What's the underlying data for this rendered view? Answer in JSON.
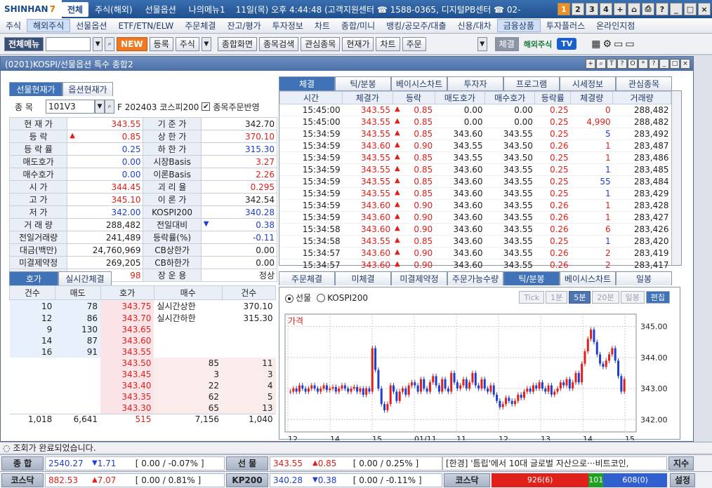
{
  "titlebar": {
    "logo": "SHINHAN",
    "logo_num": "7",
    "menus": [
      "전체",
      "주식(해외)",
      "선물옵션",
      "나의메뉴1"
    ],
    "active_menu": "전체",
    "info": "11일(목) 오후 4:44:48 (고객지원센터 ☎ 1588-0365, 디지털PB센터 ☎ 02-",
    "nums": [
      "1",
      "2",
      "3",
      "4",
      "+"
    ]
  },
  "menubar": [
    "주식",
    "해외주식",
    "선물옵션",
    "ETF/ETN/ELW",
    "주문체결",
    "잔고/평가",
    "투자정보",
    "차트",
    "종합/미니",
    "뱅킹/공모주/대출",
    "신용/대차",
    "금융상품",
    "투자플러스",
    "온라인지점"
  ],
  "menubar_selected": [
    "해외주식",
    "금융상품"
  ],
  "toolbar": {
    "allmenu": "전체메뉴",
    "new": "NEW",
    "buttons": [
      "등록",
      "주식"
    ],
    "buttons2": [
      "종합화면",
      "종목검색",
      "관심종목",
      "현재가",
      "차트",
      "주문"
    ],
    "fill": "체결",
    "brand": "해외주식",
    "tv": "TV"
  },
  "window": {
    "title": "(0201)KOSPI/선물옵션 특수 종합2"
  },
  "lefttabs": [
    "선물현재가",
    "옵션현재가"
  ],
  "code": {
    "label": "종  목",
    "value": "101V3",
    "name": "F 202403 코스피200",
    "check_label": "종목주문반영"
  },
  "quote": [
    [
      "현 재 가",
      "343.55",
      "red",
      "",
      "기 준 가",
      "342.70",
      ""
    ],
    [
      "등    락",
      "0.85",
      "red",
      "up",
      "상 한 가",
      "370.10",
      "red"
    ],
    [
      "등 락 률",
      "0.25",
      "blue",
      "",
      "하 한 가",
      "315.30",
      "blue"
    ],
    [
      "매도호가",
      "0.00",
      "blue",
      "",
      "시장Basis",
      "3.27",
      "red"
    ],
    [
      "매수호가",
      "0.00",
      "blue",
      "",
      "이론Basis",
      "2.26",
      "red"
    ],
    [
      "시    가",
      "344.45",
      "red",
      "",
      "괴 리 율",
      "0.295",
      "red"
    ],
    [
      "고    가",
      "345.10",
      "red",
      "",
      "이 론 가",
      "342.54",
      ""
    ],
    [
      "저    가",
      "342.00",
      "blue",
      "",
      "KOSPI200",
      "340.28",
      "blue"
    ],
    [
      "거 래 량",
      "288,482",
      "",
      "",
      "전일대비",
      "0.38",
      "blue"
    ],
    [
      "전일거래량",
      "241,489",
      "",
      "",
      "등락률(%)",
      "-0.11",
      "blue"
    ],
    [
      "대금(백만)",
      "24,760,969",
      "",
      "",
      "CB상한가",
      "0.00",
      ""
    ],
    [
      "미결제약정",
      "269,205",
      "",
      "",
      "CB하한가",
      "0.00",
      ""
    ],
    [
      "미결제증감",
      "98",
      "red",
      "",
      "장 운 용",
      "정상",
      ""
    ]
  ],
  "righttabs": [
    "체결",
    "틱/분봉",
    "베이시스차트",
    "투자자",
    "프로그램",
    "시세정보",
    "관심종목"
  ],
  "trades": {
    "headers": [
      "시간",
      "체결가",
      "등락",
      "매도호가",
      "매수호가",
      "등락률",
      "체결량",
      "거래량"
    ],
    "rows": [
      [
        "15:45:00",
        "343.55",
        "0.85",
        "0.00",
        "0.00",
        "0.25",
        "0",
        "288,482",
        "red"
      ],
      [
        "15:45:00",
        "343.55",
        "0.85",
        "0.00",
        "0.00",
        "0.25",
        "4,990",
        "288,482",
        "red"
      ],
      [
        "15:34:59",
        "343.55",
        "0.85",
        "343.60",
        "343.55",
        "0.25",
        "5",
        "283,492",
        "blue"
      ],
      [
        "15:34:59",
        "343.60",
        "0.90",
        "343.55",
        "343.50",
        "0.26",
        "1",
        "283,487",
        "red"
      ],
      [
        "15:34:59",
        "343.55",
        "0.85",
        "343.55",
        "343.50",
        "0.25",
        "1",
        "283,486",
        "red"
      ],
      [
        "15:34:59",
        "343.55",
        "0.85",
        "343.60",
        "343.55",
        "0.25",
        "1",
        "283,485",
        "blue"
      ],
      [
        "15:34:59",
        "343.55",
        "0.85",
        "343.60",
        "343.55",
        "0.25",
        "55",
        "283,484",
        "blue"
      ],
      [
        "15:34:59",
        "343.55",
        "0.85",
        "343.60",
        "343.55",
        "0.25",
        "1",
        "283,429",
        "blue"
      ],
      [
        "15:34:59",
        "343.60",
        "0.90",
        "343.60",
        "343.55",
        "0.26",
        "1",
        "283,428",
        "red"
      ],
      [
        "15:34:59",
        "343.60",
        "0.90",
        "343.60",
        "343.55",
        "0.26",
        "1",
        "283,427",
        "red"
      ],
      [
        "15:34:58",
        "343.60",
        "0.90",
        "343.60",
        "343.55",
        "0.26",
        "6",
        "283,426",
        "red"
      ],
      [
        "15:34:58",
        "343.55",
        "0.85",
        "343.60",
        "343.55",
        "0.25",
        "1",
        "283,420",
        "blue"
      ],
      [
        "15:34:57",
        "343.60",
        "0.90",
        "343.60",
        "343.55",
        "0.26",
        "2",
        "283,419",
        "red"
      ],
      [
        "15:34:57",
        "343.60",
        "0.90",
        "343.60",
        "343.55",
        "0.26",
        "2",
        "283,417",
        "red"
      ]
    ]
  },
  "bottomlefttabs": [
    "호가",
    "실시간체결"
  ],
  "orderbook": {
    "headers": [
      "건수",
      "매도",
      "호가",
      "매수",
      "건수"
    ],
    "asks": [
      [
        "10",
        "78",
        "343.75"
      ],
      [
        "12",
        "86",
        "343.70"
      ],
      [
        "9",
        "130",
        "343.65"
      ],
      [
        "14",
        "87",
        "343.60"
      ],
      [
        "16",
        "91",
        "343.55"
      ]
    ],
    "bids": [
      [
        "343.50",
        "85",
        "11"
      ],
      [
        "343.45",
        "3",
        "3"
      ],
      [
        "343.40",
        "22",
        "4"
      ],
      [
        "343.35",
        "62",
        "5"
      ],
      [
        "343.30",
        "65",
        "13"
      ]
    ],
    "limit_labels": [
      [
        "실시간상한",
        "370.10"
      ],
      [
        "실시간하한",
        "315.30"
      ]
    ],
    "totals": [
      "1,018",
      "6,641",
      "515",
      "7,156",
      "1,040"
    ]
  },
  "bottomrighttabs": [
    "주문체결",
    "미체결",
    "미결제약정",
    "주문가능수량",
    "틱/분봉",
    "베이시스차트",
    "일봉"
  ],
  "chartpanel": {
    "radios": [
      "선물",
      "KOSPI200"
    ],
    "periods": [
      "Tick",
      "1분",
      "5분",
      "20분",
      "일봉",
      "편집"
    ],
    "periods_on": "5분",
    "label": "가격"
  },
  "chart_data": {
    "type": "candlestick",
    "title": "가격",
    "y_ticks": [
      "345.00",
      "344.00",
      "343.00",
      "342.00"
    ],
    "ylim": [
      341.6,
      345.4
    ],
    "x_ticks": [
      "12",
      "14",
      "15",
      "01/11",
      "11",
      "12",
      "13",
      "14",
      "15"
    ],
    "closes": [
      342.9,
      343.0,
      342.9,
      343.1,
      343.0,
      342.9,
      343.0,
      343.1,
      343.0,
      342.9,
      343.0,
      343.1,
      342.95,
      343.0,
      343.05,
      342.9,
      343.0,
      343.1,
      343.0,
      342.9,
      343.0,
      343.05,
      342.9,
      343.0,
      342.8,
      343.0,
      342.9,
      344.3,
      343.6,
      343.0,
      342.5,
      342.3,
      342.5,
      343.1,
      342.9,
      342.6,
      342.9,
      343.0,
      342.8,
      343.1,
      343.2,
      343.1,
      342.9,
      343.3,
      343.0,
      342.9,
      343.2,
      343.4,
      343.1,
      342.9,
      343.3,
      343.0,
      342.9,
      343.5,
      343.2,
      343.0,
      343.1,
      343.3,
      343.0,
      343.2,
      343.5,
      343.1,
      343.0,
      343.3,
      343.0,
      342.9,
      343.1,
      342.8,
      342.6,
      342.4,
      342.5,
      342.7,
      342.6,
      342.5,
      342.6,
      342.8,
      342.7,
      342.9,
      343.0,
      342.9,
      343.1,
      343.0,
      343.2,
      343.0,
      342.9,
      343.1,
      342.8,
      342.9,
      343.0,
      343.2,
      343.1,
      343.3,
      343.0,
      343.2,
      343.5,
      343.2,
      343.8,
      344.2,
      344.6,
      344.9,
      344.5,
      344.1,
      343.8,
      343.7,
      343.9,
      344.1,
      344.3,
      343.9,
      343.4,
      342.9,
      343.3
    ]
  },
  "status": "조회가 완료되었습니다.",
  "ticker1": {
    "l1": "종  합",
    "v1": "2540.27",
    "c1": "1.71",
    "p1": "[ 0.00  / -0.07% ]",
    "l2": "선  물",
    "v2": "343.55",
    "c2": "0.85",
    "p2": "[ 0.00  / 0.25% ]",
    "news": "[한경] '틈립'에서 10대 글로벌 자산으로···비트코인,",
    "btn": "지수"
  },
  "ticker2": {
    "l1": "코스닥",
    "v1": "882.53",
    "c1": "7.07",
    "p1": "[ 0.00  / 0.81% ]",
    "l2": "KP200",
    "v2": "340.28",
    "c2": "0.38",
    "p2": "[ 0.00  / -0.11% ]",
    "l3": "코스닥",
    "a": "926(6)",
    "b": "101",
    "c": "608(0)",
    "btn": "설정"
  },
  "colors": {
    "up": "#e0201a",
    "down": "#1e3fcf",
    "accent": "#3f72b6"
  }
}
